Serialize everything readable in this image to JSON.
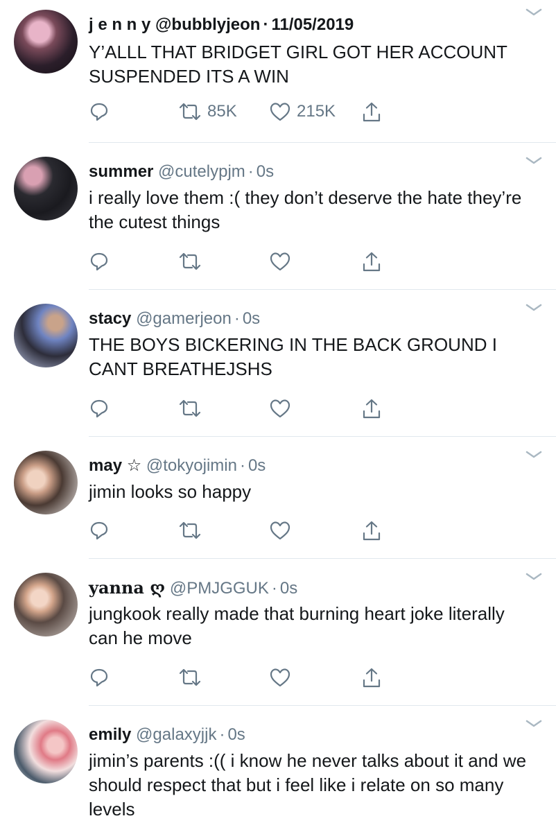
{
  "tweets": [
    {
      "name": "j e n n y",
      "handle": "@bubblyjeon",
      "sep": "·",
      "time": "11/05/2019",
      "text": "Y’ALLL THAT BRIDGET GIRL GOT HER ACCOUNT SUSPENDED ITS A WIN",
      "retweets": "85K",
      "likes": "215K"
    },
    {
      "name": "summer",
      "handle": "@cutelypjm",
      "sep": "·",
      "time": "0s",
      "text": "i really love them :( they don’t deserve the hate they’re the cutest things",
      "retweets": "",
      "likes": ""
    },
    {
      "name": "stacy",
      "handle": "@gamerjeon",
      "sep": "·",
      "time": "0s",
      "text": "THE BOYS BICKERING IN THE BACK GROUND I CANT BREATHEJSHS",
      "retweets": "",
      "likes": ""
    },
    {
      "name": "may ☆",
      "handle": "@tokyojimin",
      "sep": "·",
      "time": "0s",
      "text": "jimin looks so happy",
      "retweets": "",
      "likes": ""
    },
    {
      "name": "yanna ღ",
      "handle": "@PMJGGUK",
      "sep": "·",
      "time": "0s",
      "text": "jungkook really made that burning heart joke literally can he move",
      "retweets": "",
      "likes": ""
    },
    {
      "name": "emily",
      "handle": "@galaxyjjk",
      "sep": "·",
      "time": "0s",
      "text": "jimin’s parents :(( i know he never talks about it and we should respect that but i feel like i relate on so many levels",
      "retweets": "",
      "likes": ""
    }
  ],
  "icons": {
    "reply": "reply-icon",
    "retweet": "retweet-icon",
    "like": "like-icon",
    "share": "share-icon",
    "caret": "chevron-down-icon"
  },
  "colors": {
    "text": "#14171a",
    "muted": "#657786",
    "divider": "#e1e8ed"
  }
}
